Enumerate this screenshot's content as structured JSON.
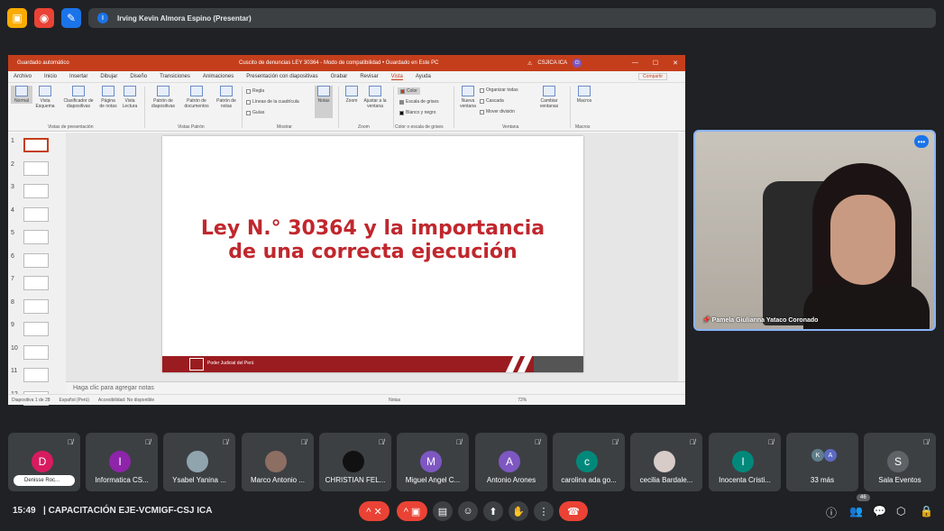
{
  "top": {
    "presenter": "Irving Kevin Almora Espino (Presentar)",
    "presenter_initial": "I"
  },
  "ppt": {
    "autosave": "Guardado automático",
    "title": "Cuscito de denuncias LEY 30364 - Modo de compatibilidad • Guardado en Este PC",
    "user": "CSJICA ICA",
    "user_initial": "CI",
    "menu": [
      "Archivo",
      "Inicio",
      "Insertar",
      "Dibujar",
      "Diseño",
      "Transiciones",
      "Animaciones",
      "Presentación con diapositivas",
      "Grabar",
      "Revisar",
      "Vista",
      "Ayuda"
    ],
    "share": "Compartir",
    "ribbon": {
      "normal": "Normal",
      "esquema": "Vista Esquema",
      "clasificador": "Clasificador de diapositivas",
      "pagina_notas": "Página de notas",
      "lectura": "Vista Lectura",
      "grp_vistas": "Vistas de presentación",
      "patron_diap": "Patrón de diapositivas",
      "patron_doc": "Patrón de documentos",
      "patron_notas": "Patrón de notas",
      "grp_patron": "Vistas Patrón",
      "regla": "Regla",
      "lineas": "Líneas de la cuadrícula",
      "guias": "Guías",
      "notas": "Notas",
      "grp_mostrar": "Mostrar",
      "zoom": "Zoom",
      "ajustar": "Ajustar a la ventana",
      "grp_zoom": "Zoom",
      "color": "Color",
      "grises": "Escala de grises",
      "blanco": "Blanco y negro",
      "grp_color": "Color o escala de grises",
      "nueva": "Nueva ventana",
      "organizar": "Organizar todas",
      "cascada": "Cascada",
      "mover": "Mover división",
      "cambiar": "Cambiar ventanas",
      "grp_ventana": "Ventana",
      "macros": "Macros",
      "grp_macros": "Macros"
    },
    "thumb_numbers": [
      "1",
      "2",
      "3",
      "4",
      "5",
      "6",
      "7",
      "8",
      "9",
      "10",
      "11",
      "12"
    ],
    "slide_title_1": "Ley N.° 30364 y la importancia",
    "slide_title_2": "de una correcta ejecución",
    "slide_footer": "Poder Judicial del Perú",
    "notes_placeholder": "Haga clic para agregar notas",
    "status": {
      "slide": "Diapositiva 1 de 28",
      "lang": "Español (Perú)",
      "access": "Accesibilidad: No disponible",
      "notes": "Notas",
      "zoom": "72%"
    }
  },
  "camera": {
    "name": "Pamela Giulianna Yataco Coronado"
  },
  "participants": [
    {
      "initial": "D",
      "name": "Denisse Roc...",
      "color": "#d81b60"
    },
    {
      "initial": "I",
      "name": "Informatica CS...",
      "color": "#8e24aa"
    },
    {
      "initial": "",
      "name": "Ysabel Yanina ...",
      "color": "#90a4ae"
    },
    {
      "initial": "",
      "name": "Marco Antonio ...",
      "color": "#8d6e63"
    },
    {
      "initial": "",
      "name": "CHRISTIAN FEL...",
      "color": "#111111"
    },
    {
      "initial": "M",
      "name": "Miguel Angel C...",
      "color": "#7e57c2"
    },
    {
      "initial": "A",
      "name": "Antonio Arones",
      "color": "#7e57c2"
    },
    {
      "initial": "c",
      "name": "carolina ada go...",
      "color": "#00897b"
    },
    {
      "initial": "",
      "name": "cecilia Bardale...",
      "color": "#d7ccc8"
    },
    {
      "initial": "I",
      "name": "Inocenta Cristi...",
      "color": "#00897b"
    },
    {
      "initial": "",
      "name": "33 más",
      "color": "#5c6bc0"
    },
    {
      "initial": "S",
      "name": "Sala Eventos",
      "color": "#5f6368"
    }
  ],
  "more_initials": [
    "K",
    "A"
  ],
  "bottom": {
    "time": "15:49",
    "meeting": "CAPACITACIÓN EJE-VCMIGF-CSJ ICA",
    "participant_count": "46"
  },
  "colors": {
    "ppt_accent": "#c43e1c",
    "meet_bg": "#202124",
    "tile_bg": "#3c4043",
    "end_call": "#ea4335"
  }
}
